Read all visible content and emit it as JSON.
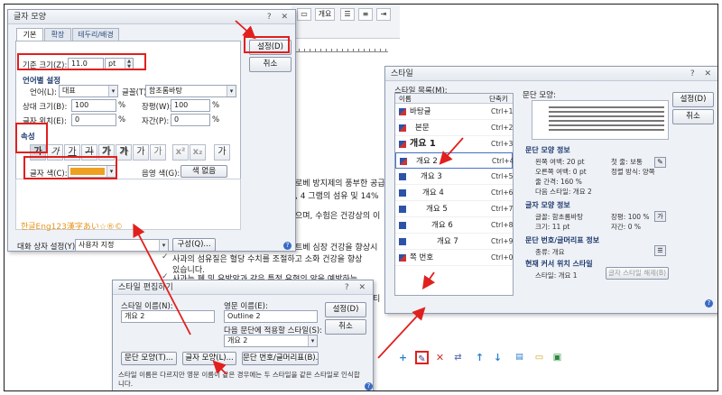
{
  "background_doc": {
    "ribbon_label": "개요",
    "lines": [
      "로베 방지제의 풍부한 공급",
      ", 4 그램의 섬유 및 14%",
      "으며, 수험은 건강상의 이",
      "트베 심장 건강을 향상시",
      "사과의 섬유질은 혈당 수치를 조절하고 소화 건강을 향상",
      "있습니다.",
      "사과는 폐 및 유방암과 같은 특정 유형의 암을 예방하는",
      "티"
    ],
    "check_glyph": "✓"
  },
  "char_dialog": {
    "title": "글자 모양",
    "tabs": [
      "기본",
      "확장",
      "테두리/배경"
    ],
    "base_size_label": "기준 크기(Z):",
    "base_size_value": "11.0",
    "base_size_unit": "pt",
    "set_button": "설정(D)",
    "cancel_button": "취소",
    "lang_group_title": "언어별 설정",
    "lang_label": "언어(L):",
    "lang_value": "대표",
    "font_label": "글꼴(T):",
    "font_value": "함초롬바탕",
    "rel_size_label": "상대 크기(B):",
    "rel_size_value": "100",
    "spacing_label": "장평(W):",
    "spacing_value": "100",
    "pos_label": "글자 위치(E):",
    "pos_value": "0",
    "kern_label": "자간(P):",
    "kern_value": "0",
    "percent": "%",
    "attr_title": "속성",
    "attr_buttons": [
      "가",
      "가",
      "가",
      "가",
      "가",
      "가",
      "가",
      "가",
      "",
      "",
      "가"
    ],
    "color_label": "글자 색(C):",
    "color_value": "#f0a020",
    "shade_label": "음영 색(G):",
    "shade_value": "색 없음",
    "preview_text": "한글Eng123漢字あい☆®©",
    "preview_color": "#e8951a",
    "default_label": "대화 상자 설정(Y):",
    "default_value": "사용자 지정",
    "config_button": "구성(Q)...",
    "help": "?"
  },
  "style_editor": {
    "title": "스타일 편집하기",
    "name_label": "스타일 이름(N):",
    "name_value": "개요 2",
    "eng_label": "영문 이름(E):",
    "eng_value": "Outline 2",
    "next_label": "다음 문단에 적용할 스타일(S):",
    "next_value": "개요 2",
    "set_button": "설정(D)",
    "cancel_button": "취소",
    "para_button": "문단 모양(T)...",
    "char_button": "글자 모양(L)...",
    "num_button": "문단 번호/글머리표(B)...",
    "note": "스타일 이름은 다르지만 영문 이름이 같은 경우에는 두 스타일을 같은 스타일로 인식합니다.",
    "help": "?"
  },
  "style_dialog": {
    "title": "스타일",
    "list_label": "스타일 목록(M):",
    "col_name": "이름",
    "col_shortcut": "단축키",
    "styles": [
      {
        "name": "바탕글",
        "key": "Ctrl+1"
      },
      {
        "name": "본문",
        "key": "Ctrl+2"
      },
      {
        "name": "개요 1",
        "key": "Ctrl+3"
      },
      {
        "name": "개요 2",
        "key": "Ctrl+4"
      },
      {
        "name": "개요 3",
        "key": "Ctrl+5"
      },
      {
        "name": "개요 4",
        "key": "Ctrl+6"
      },
      {
        "name": "개요 5",
        "key": "Ctrl+7"
      },
      {
        "name": "개요 6",
        "key": "Ctrl+8"
      },
      {
        "name": "개요 7",
        "key": "Ctrl+9"
      },
      {
        "name": "쪽 번호",
        "key": "Ctrl+0"
      }
    ],
    "preview_label": "문단 모양:",
    "set_button": "설정(D)",
    "cancel_button": "취소",
    "para_info_title": "문단 모양 정보",
    "para_info": [
      "왼쪽 여백: 20 pt",
      "첫 줄: 보통",
      "오른쪽 여백: 0 pt",
      "정렬 방식: 양쪽",
      "줄 간격: 160 %",
      "다음 스타일: 개요 2"
    ],
    "char_info_title": "글자 모양 정보",
    "char_info": [
      "글꼴: 함초롬바탕",
      "장평: 100 %",
      "크기: 11 pt",
      "자간: 0 %"
    ],
    "num_info_title": "문단 번호/글머리표 정보",
    "num_info": "종류: 개요",
    "current_title": "현재 커서 위치 스타일",
    "current_style": "스타일: 개요 1",
    "current_button": "글자 스타일 해제(B)",
    "help": "?"
  },
  "colors": {
    "annotation_red": "#e0201e",
    "dialog_bg": "#eef1f6"
  }
}
